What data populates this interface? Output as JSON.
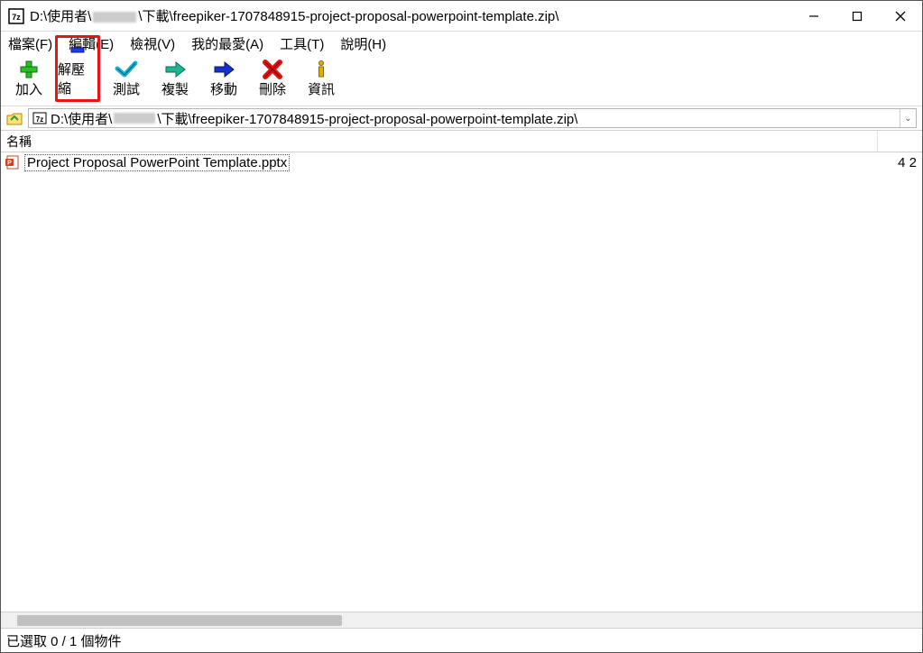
{
  "window": {
    "title_prefix": "D:\\使用者\\",
    "title_suffix": "\\下載\\freepiker-1707848915-project-proposal-powerpoint-template.zip\\"
  },
  "menu": {
    "file": "檔案(F)",
    "edit": "編輯(E)",
    "view": "檢視(V)",
    "favorites": "我的最愛(A)",
    "tools": "工具(T)",
    "help": "說明(H)"
  },
  "toolbar": {
    "add": "加入",
    "extract": "解壓縮",
    "test": "測試",
    "copy": "複製",
    "move": "移動",
    "delete": "刪除",
    "info": "資訊"
  },
  "path": {
    "prefix": "D:\\使用者\\",
    "suffix": "\\下載\\freepiker-1707848915-project-proposal-powerpoint-template.zip\\"
  },
  "columns": {
    "name": "名稱"
  },
  "files": [
    {
      "icon": "pptx",
      "name": "Project Proposal PowerPoint Template.pptx",
      "right": "4 2"
    }
  ],
  "status": {
    "text": "已選取 0 / 1 個物件"
  },
  "icons": {
    "app": "7z",
    "minimize": "—",
    "maximize": "▢",
    "close": "✕",
    "dropdown": "⌄"
  }
}
